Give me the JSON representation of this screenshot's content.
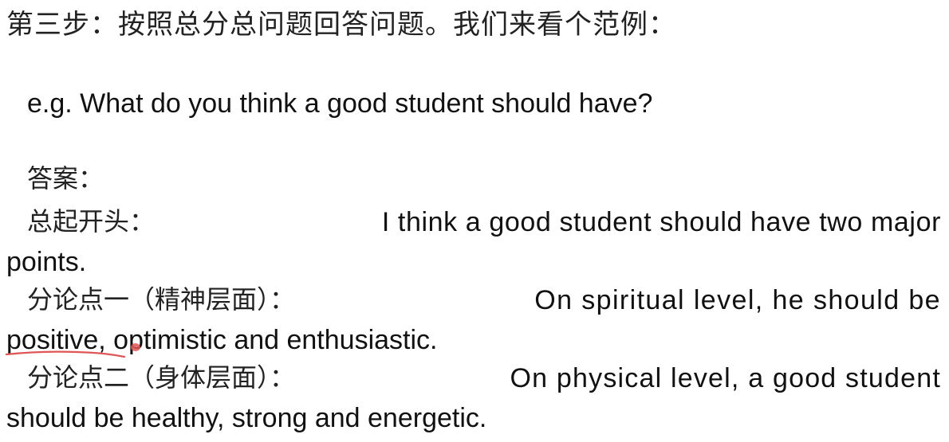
{
  "step_heading": "第三步：按照总分总问题回答问题。我们来看个范例：",
  "example_question": "e.g. What do you think a good student should have?",
  "answer_label": "答案：",
  "opening": {
    "label": "总起开头：",
    "text_line1": "I think a good student should have two major",
    "text_line2": "points."
  },
  "point_one": {
    "label": "分论点一（精神层面）：",
    "text_line1": "On spiritual level, he should be",
    "text_line2": "positive, optimistic and enthusiastic."
  },
  "point_two": {
    "label": "分论点二（身体层面）：",
    "text_line1": "On physical level, a good student",
    "text_line2": "should be healthy, strong and energetic."
  },
  "annotation_color": "#e05555"
}
